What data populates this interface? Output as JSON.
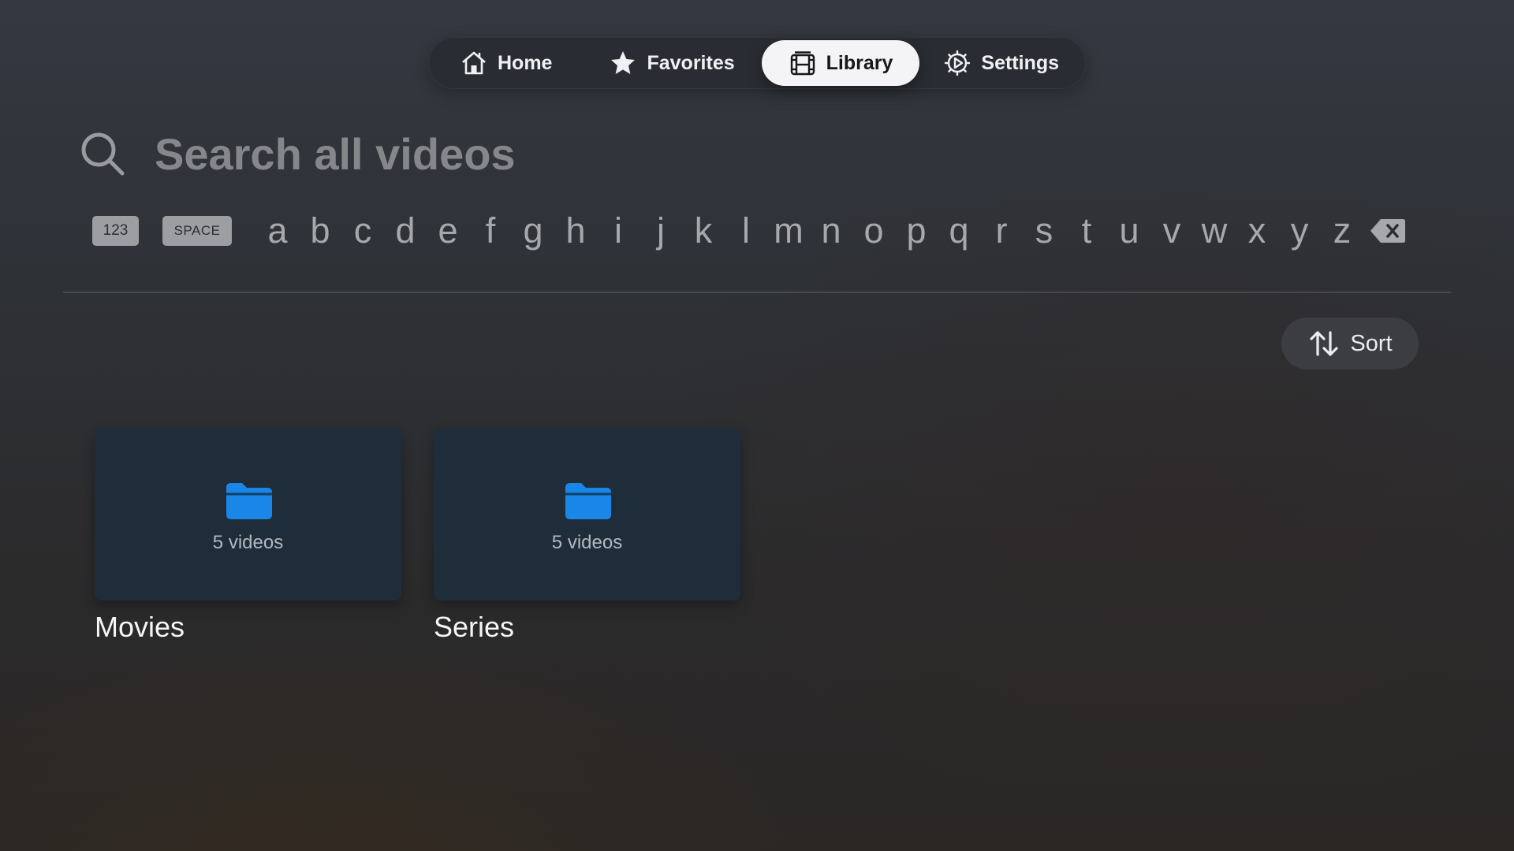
{
  "nav": {
    "items": [
      {
        "label": "Home",
        "icon": "house-icon"
      },
      {
        "label": "Favorites",
        "icon": "star-icon"
      },
      {
        "label": "Library",
        "icon": "film-icon",
        "active": true
      },
      {
        "label": "Settings",
        "icon": "gear-icon"
      }
    ]
  },
  "search": {
    "placeholder": "Search all videos",
    "icon": "magnifier-icon"
  },
  "keyboard": {
    "numbers_key": "123",
    "space_key": "SPACE",
    "letters": [
      "a",
      "b",
      "c",
      "d",
      "e",
      "f",
      "g",
      "h",
      "i",
      "j",
      "k",
      "l",
      "m",
      "n",
      "o",
      "p",
      "q",
      "r",
      "s",
      "t",
      "u",
      "v",
      "w",
      "x",
      "y",
      "z"
    ],
    "delete_icon": "delete-left-icon"
  },
  "sort": {
    "label": "Sort",
    "icon": "arrow-up-down-icon"
  },
  "folders": [
    {
      "name": "Movies",
      "count": "5 videos",
      "icon": "folder-icon"
    },
    {
      "name": "Series",
      "count": "5 videos",
      "icon": "folder-icon"
    }
  ],
  "colors": {
    "folder_blue": "#1a86e8",
    "tile_bg": "#1f2d3a",
    "active_nav_bg": "#f4f4f6"
  }
}
